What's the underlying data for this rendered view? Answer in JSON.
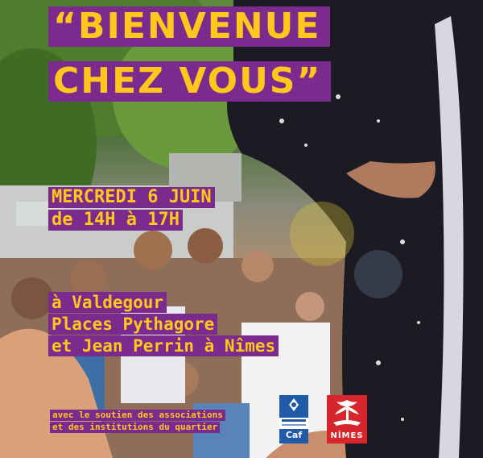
{
  "poster": {
    "title_line1": "“BIENVENUE",
    "title_line2": "CHEZ VOUS”",
    "date_line1": "MERCREDI 6 JUIN",
    "date_line2": "de 14H à 17H",
    "place_line1": "à Valdegour",
    "place_line2": "Places Pythagore",
    "place_line3": "et Jean Perrin à Nîmes",
    "support_line1": "avec le soutien des associations",
    "support_line2": "et des institutions du quartier",
    "logo_caf_label": "Caf",
    "logo_nimes_label": "NÎMES"
  },
  "colors": {
    "band": "#7b2a8d",
    "text": "#ffc71b",
    "nimes_red": "#d7262b",
    "caf_blue": "#1f5ba8"
  }
}
